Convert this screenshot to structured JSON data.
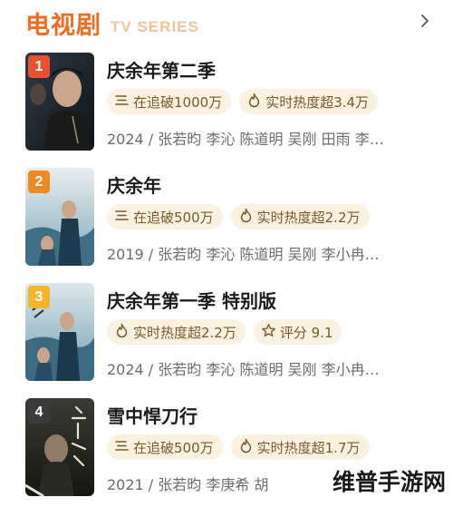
{
  "header": {
    "title_cn": "电视剧",
    "title_en": "TV SERIES",
    "more_icon": "chevron-right-icon"
  },
  "colors": {
    "accent": "#ef6d22",
    "rank1": "#e8512f",
    "rank2": "#f08a1f",
    "rank3": "#f5b52a",
    "rank4": "#3a3a3a",
    "tag_bg": "#fbf1e0",
    "tag_text": "#7a5a2c"
  },
  "items": [
    {
      "rank": "1",
      "title": "庆余年第二季",
      "tags": [
        {
          "icon": "list-lines-icon",
          "text": "在追破1000万"
        },
        {
          "icon": "flame-icon",
          "text": "实时热度超3.4万"
        }
      ],
      "meta": "2024 / 张若昀  李沁  陈道明  吴刚  田雨  李…"
    },
    {
      "rank": "2",
      "title": "庆余年",
      "tags": [
        {
          "icon": "list-lines-icon",
          "text": "在追破500万"
        },
        {
          "icon": "flame-icon",
          "text": "实时热度超2.2万"
        }
      ],
      "meta": "2019 / 张若昀  李沁  陈道明  吴刚  李小冉…"
    },
    {
      "rank": "3",
      "title": "庆余年第一季  特别版",
      "tags": [
        {
          "icon": "flame-icon",
          "text": "实时热度超2.2万"
        },
        {
          "icon": "star-icon",
          "text": "评分  9.1"
        }
      ],
      "meta": "2024 / 张若昀  李沁  陈道明  吴刚  李小冉…"
    },
    {
      "rank": "4",
      "title": "雪中悍刀行",
      "tags": [
        {
          "icon": "list-lines-icon",
          "text": "在追破500万"
        },
        {
          "icon": "flame-icon",
          "text": "实时热度超1.7万"
        }
      ],
      "meta": "2021 / 张若昀  李庚希  胡"
    }
  ],
  "watermark": "维普手游网"
}
